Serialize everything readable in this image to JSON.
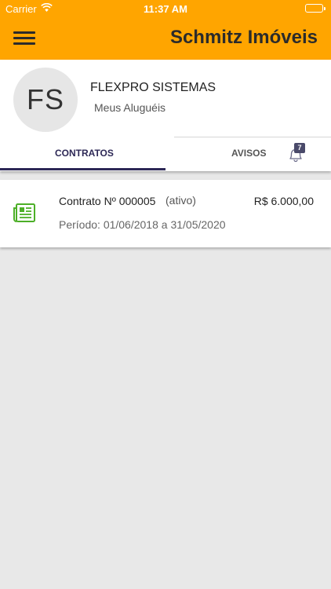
{
  "status_bar": {
    "carrier": "Carrier",
    "time": "11:37 AM"
  },
  "app_bar": {
    "title": "Schmitz Imóveis"
  },
  "profile": {
    "initials": "FS",
    "name": "FLEXPRO SISTEMAS",
    "subtitle": "Meus Aluguéis"
  },
  "tabs": [
    {
      "label": "CONTRATOS",
      "active": true
    },
    {
      "label": "AVISOS",
      "active": false
    }
  ],
  "notifications": {
    "count": "7"
  },
  "contracts": [
    {
      "title": "Contrato Nº 000005",
      "status": "(ativo)",
      "value": "R$  6.000,00",
      "period": "Período: 01/06/2018 a 31/05/2020"
    }
  ],
  "colors": {
    "primary": "#ffa500",
    "accent": "#2d2856",
    "icon_green": "#4caf27"
  }
}
